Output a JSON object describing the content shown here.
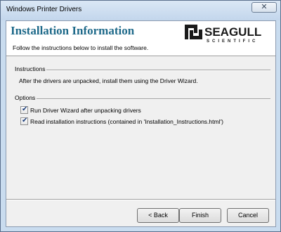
{
  "window": {
    "title": "Windows Printer Drivers",
    "close_glyph": "✕"
  },
  "header": {
    "title": "Installation Information",
    "subtitle": "Follow the instructions below to install the software.",
    "logo_text": "SEAGULL",
    "logo_subtext": "SCIENTIFIC"
  },
  "instructions": {
    "label": "Instructions",
    "text": "After the drivers are unpacked, install them using the Driver Wizard."
  },
  "options": {
    "label": "Options",
    "items": [
      {
        "label": "Run Driver Wizard after unpacking drivers",
        "checked": true
      },
      {
        "label": "Read installation instructions (contained in 'Installation_Instructions.html')",
        "checked": true
      }
    ]
  },
  "buttons": {
    "back": "< Back",
    "finish": "Finish",
    "cancel": "Cancel"
  }
}
